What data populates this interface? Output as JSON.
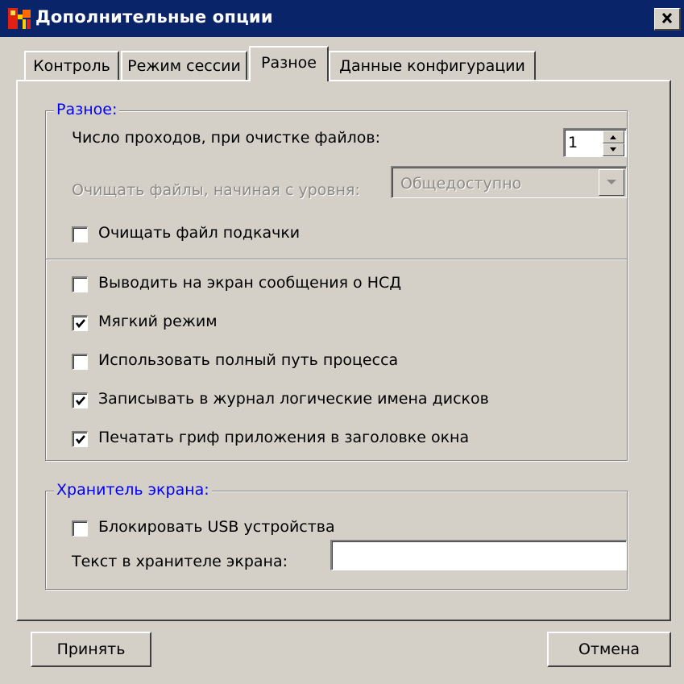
{
  "window": {
    "title": "Дополнительные опции"
  },
  "tabs": [
    {
      "label": "Контроль",
      "active": false
    },
    {
      "label": "Режим сессии",
      "active": false
    },
    {
      "label": "Разное",
      "active": true
    },
    {
      "label": "Данные конфигурации",
      "active": false
    }
  ],
  "misc_group": {
    "legend": "Разное:",
    "passes_label": "Число проходов, при очистке файлов:",
    "passes_value": "1",
    "clean_level_label": "Очищать файлы, начиная с уровня:",
    "clean_level_value": "Общедоступно",
    "swapfile_label": "Очищать файл подкачки",
    "swapfile_checked": false
  },
  "options": [
    {
      "label": "Выводить на экран сообщения о НСД",
      "checked": false
    },
    {
      "label": "Мягкий режим",
      "checked": true
    },
    {
      "label": "Использовать полный путь процесса",
      "checked": false
    },
    {
      "label": "Записывать в журнал логические имена дисков",
      "checked": true
    },
    {
      "label": "Печатать гриф приложения в заголовке окна",
      "checked": true
    }
  ],
  "screensaver_group": {
    "legend": "Хранитель экрана:",
    "block_usb_label": "Блокировать USB устройства",
    "block_usb_checked": false,
    "text_label": "Текст в хранителе экрана:",
    "text_value": ""
  },
  "buttons": {
    "accept": "Принять",
    "cancel": "Отмена"
  },
  "colors": {
    "title_bar": "#0a246a",
    "legend_text": "#0000ff",
    "dialog_bg": "#d4d0c8"
  }
}
